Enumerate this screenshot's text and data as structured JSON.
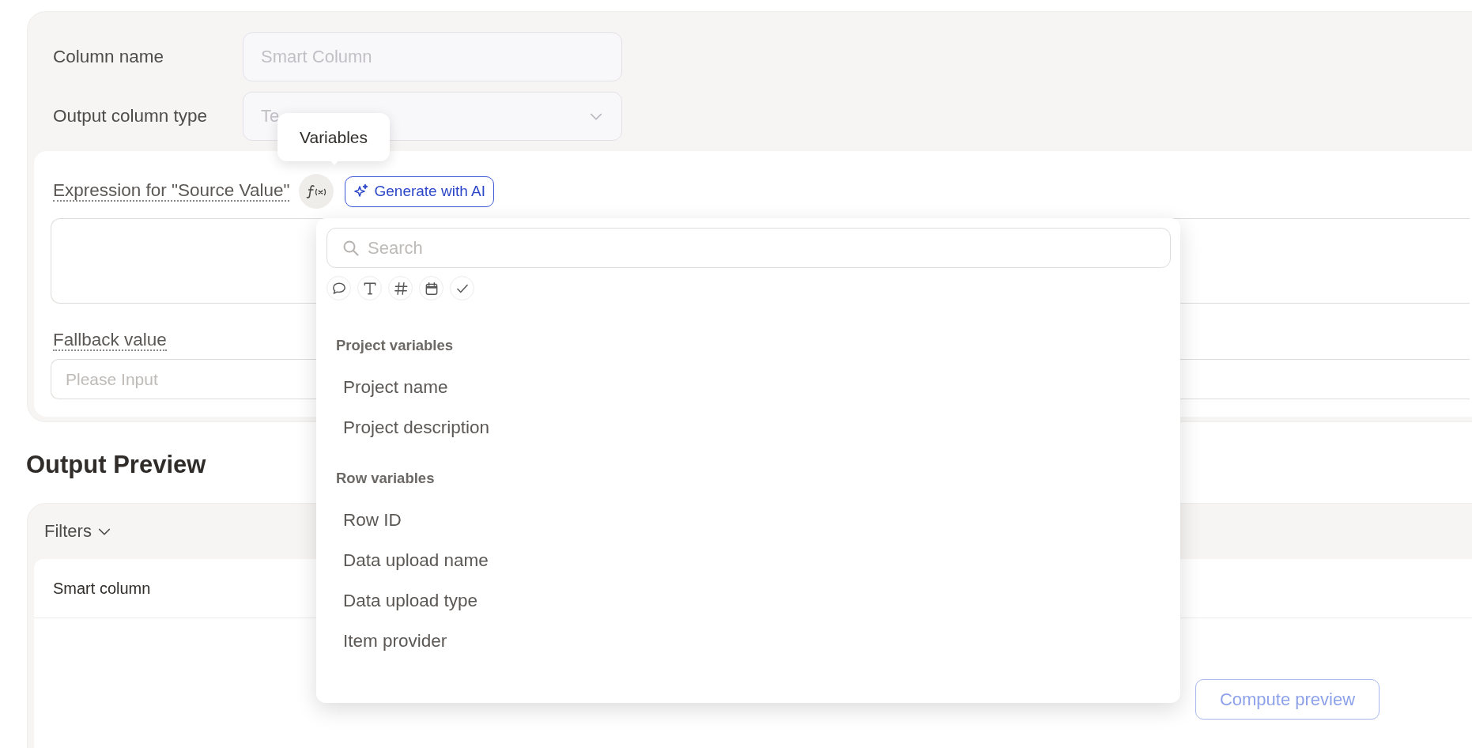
{
  "form": {
    "column_name": {
      "label": "Column name",
      "placeholder": "Smart Column"
    },
    "output_type": {
      "label": "Output column type",
      "value": "Te"
    },
    "expression": {
      "label": "Expression for \"Source Value\"",
      "ai_button": "Generate with AI"
    },
    "fallback": {
      "label": "Fallback value",
      "placeholder": "Please Input"
    }
  },
  "tooltip": {
    "text": "Variables"
  },
  "variables_menu": {
    "search_placeholder": "Search",
    "type_filters": [
      {
        "kind": "comment"
      },
      {
        "kind": "text"
      },
      {
        "kind": "number"
      },
      {
        "kind": "date"
      },
      {
        "kind": "boolean"
      }
    ],
    "sections": [
      {
        "title": "Project variables",
        "items": [
          "Project name",
          "Project description"
        ]
      },
      {
        "title": "Row variables",
        "items": [
          "Row ID",
          "Data upload name",
          "Data upload type",
          "Item provider"
        ]
      }
    ]
  },
  "output_preview": {
    "title": "Output Preview",
    "filters": "Filters",
    "column_header": "Smart column",
    "compute_button": "Compute preview"
  }
}
